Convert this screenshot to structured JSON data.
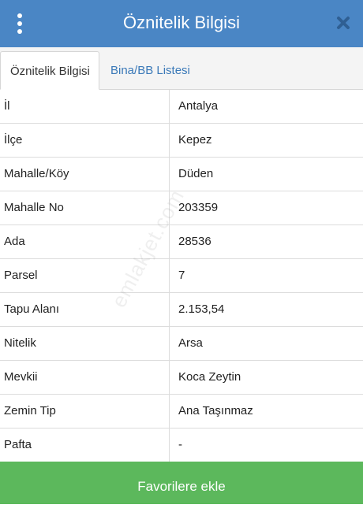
{
  "header": {
    "title": "Öznitelik Bilgisi",
    "menu_icon": "vertical-dots-icon",
    "close_icon": "close-icon"
  },
  "tabs": [
    {
      "label": "Öznitelik Bilgisi",
      "active": true
    },
    {
      "label": "Bina/BB Listesi",
      "active": false
    }
  ],
  "rows": [
    {
      "key": "İl",
      "value": "Antalya"
    },
    {
      "key": "İlçe",
      "value": "Kepez"
    },
    {
      "key": "Mahalle/Köy",
      "value": "Düden"
    },
    {
      "key": "Mahalle No",
      "value": "203359"
    },
    {
      "key": "Ada",
      "value": "28536"
    },
    {
      "key": "Parsel",
      "value": "7"
    },
    {
      "key": "Tapu Alanı",
      "value": "2.153,54"
    },
    {
      "key": "Nitelik",
      "value": "Arsa"
    },
    {
      "key": "Mevkii",
      "value": "Koca Zeytin"
    },
    {
      "key": "Zemin Tip",
      "value": "Ana Taşınmaz"
    },
    {
      "key": "Pafta",
      "value": "-"
    }
  ],
  "watermark": "emlakjet.com",
  "footer": {
    "button_label": "Favorilere ekle"
  },
  "colors": {
    "header": "#4a86c5",
    "button": "#5cb85c",
    "tab_link": "#3a79b8"
  }
}
